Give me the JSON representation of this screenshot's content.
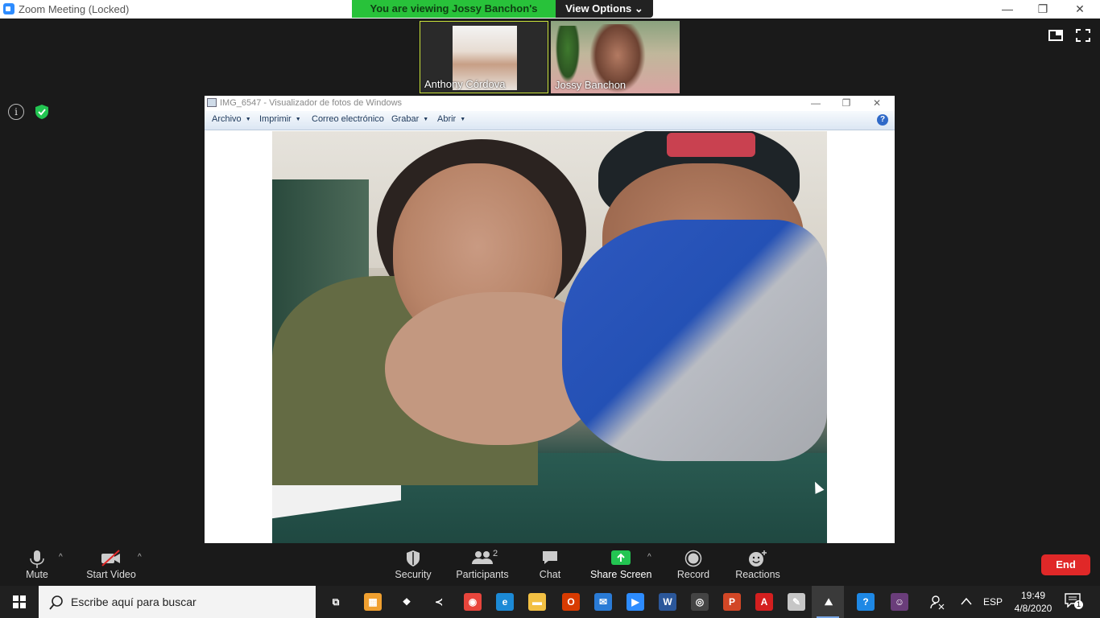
{
  "zoom_window": {
    "title": "Zoom Meeting (Locked)",
    "minimize": "—",
    "restore": "❐",
    "close": "✕"
  },
  "share_banner": {
    "text": "You are viewing Jossy Banchon's screen",
    "view_options": "View Options",
    "view_options_caret": "⌄",
    "banner_color": "#28c23a"
  },
  "participants_strip": [
    {
      "name": "Anthony Córdova",
      "active_speaker": true
    },
    {
      "name": "Jossy Banchon",
      "active_speaker": false
    }
  ],
  "photo_viewer": {
    "title": "IMG_6547 - Visualizador de fotos de Windows",
    "menus": [
      {
        "label": "Archivo",
        "has_caret": true
      },
      {
        "label": "Imprimir",
        "has_caret": true
      },
      {
        "label": "Correo electrónico",
        "has_caret": false
      },
      {
        "label": "Grabar",
        "has_caret": true
      },
      {
        "label": "Abrir",
        "has_caret": true
      }
    ],
    "help": "?",
    "minimize": "—",
    "restore": "❐",
    "close": "✕"
  },
  "toolbar": {
    "mute": "Mute",
    "start_video": "Start Video",
    "security": "Security",
    "participants": "Participants",
    "participants_count": "2",
    "chat": "Chat",
    "share_screen": "Share Screen",
    "record": "Record",
    "reactions": "Reactions",
    "end": "End",
    "caret": "^"
  },
  "taskbar": {
    "search_placeholder": "Escribe aquí para buscar",
    "apps": [
      {
        "icon": "task-view-icon",
        "color": "#202020",
        "glyph": "⧉"
      },
      {
        "icon": "store-icon",
        "color": "#f0a030",
        "glyph": "▦"
      },
      {
        "icon": "dropbox-icon",
        "color": "#202020",
        "glyph": "❖"
      },
      {
        "icon": "vscode-icon",
        "color": "#202020",
        "glyph": "≺"
      },
      {
        "icon": "chrome-icon",
        "color": "#e8453c",
        "glyph": "◉"
      },
      {
        "icon": "edge-icon",
        "color": "#1c8ad6",
        "glyph": "e"
      },
      {
        "icon": "file-explorer-icon",
        "color": "#f2c043",
        "glyph": "▬"
      },
      {
        "icon": "office-icon",
        "color": "#d83b01",
        "glyph": "O"
      },
      {
        "icon": "mail-icon",
        "color": "#2a7bd6",
        "glyph": "✉"
      },
      {
        "icon": "zoom-icon",
        "color": "#2d8cff",
        "glyph": "▶"
      },
      {
        "icon": "word-icon",
        "color": "#2b579a",
        "glyph": "W"
      },
      {
        "icon": "media-player-icon",
        "color": "#444444",
        "glyph": "◎"
      },
      {
        "icon": "powerpoint-icon",
        "color": "#d24726",
        "glyph": "P"
      },
      {
        "icon": "acrobat-icon",
        "color": "#d41f1f",
        "glyph": "A"
      },
      {
        "icon": "paint-icon",
        "color": "#c6c6c6",
        "glyph": "✎"
      },
      {
        "icon": "photos-icon",
        "color": "#3a3a3a",
        "glyph": "⛰"
      },
      {
        "icon": "help-icon",
        "color": "#1e88e5",
        "glyph": "?"
      },
      {
        "icon": "avatar-app-icon",
        "color": "#6a3d7a",
        "glyph": "☺"
      }
    ],
    "language": "ESP",
    "time": "19:49",
    "date": "4/8/2020",
    "notification_count": "1"
  }
}
